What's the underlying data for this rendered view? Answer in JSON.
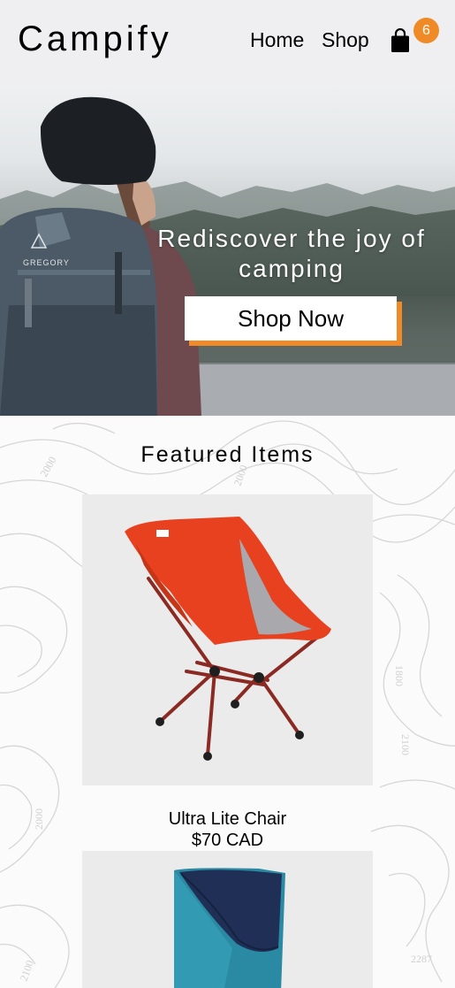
{
  "header": {
    "logo": "Campify",
    "nav": [
      {
        "label": "Home"
      },
      {
        "label": "Shop"
      }
    ],
    "cart_count": "6",
    "cart_icon": "shopping-bag-icon"
  },
  "hero": {
    "headline": "Rediscover the joy of camping",
    "cta_label": "Shop Now",
    "accent_color": "#ef8a27"
  },
  "featured": {
    "title": "Featured Items",
    "products": [
      {
        "name": "Ultra Lite Chair",
        "price": "$70 CAD"
      },
      {
        "name": "",
        "price": ""
      }
    ]
  },
  "contour_labels": [
    "2000",
    "2000",
    "1800",
    "2100",
    "2000",
    "2287",
    "2100"
  ]
}
